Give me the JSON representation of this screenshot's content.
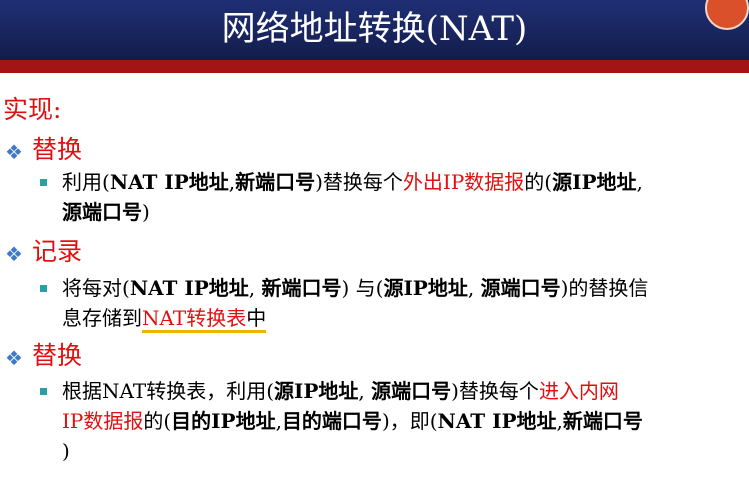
{
  "header": {
    "title": "网络地址转换(NAT)"
  },
  "section": {
    "heading": "实现:"
  },
  "items": [
    {
      "label": "替换",
      "line1_p1": "利用(",
      "line1_b1": "NAT IP地址",
      "line1_p2": ",",
      "line1_b2": "新端口号",
      "line1_p3": ")替换每个",
      "line1_r1": "外出IP数据报",
      "line1_p4": "的(",
      "line1_b3": "源IP地址",
      "line1_p5": ",",
      "line2_b1": "源端口号",
      "line2_p1": ")"
    },
    {
      "label": "记录",
      "line1_p1": "将每对(",
      "line1_b1": "NAT IP地址",
      "line1_p2": ", ",
      "line1_b2": "新端口号",
      "line1_p3": ") 与(",
      "line1_b3": "源IP地址",
      "line1_p4": ", ",
      "line1_b4": "源端口号",
      "line1_p5": ")的替换信",
      "line2_p1": "息存储到",
      "line2_r1": "NAT转换表",
      "line2_p2": "中"
    },
    {
      "label": "替换",
      "line1_p1": "根据NAT转换表，利用(",
      "line1_b1": "源IP地址",
      "line1_p2": ", ",
      "line1_b2": "源端口号",
      "line1_p3": ")替换每个",
      "line1_r1": "进入内网",
      "line2_r1": "IP数据报",
      "line2_p1": "的(",
      "line2_b1": "目的IP地址",
      "line2_p2": ",",
      "line2_b2": "目的端口号",
      "line2_p3": ")，即(",
      "line2_b3": "NAT IP地址",
      "line2_p4": ",",
      "line2_b4": "新端口号",
      "line3_p1": ")"
    }
  ],
  "colors": {
    "header_bg": "#1a2766",
    "red_bar": "#a31414",
    "accent_red": "#e01010",
    "bullet_teal": "#2aa0a4",
    "diamond_blue": "#3f78c6",
    "underline": "#f0b400"
  }
}
